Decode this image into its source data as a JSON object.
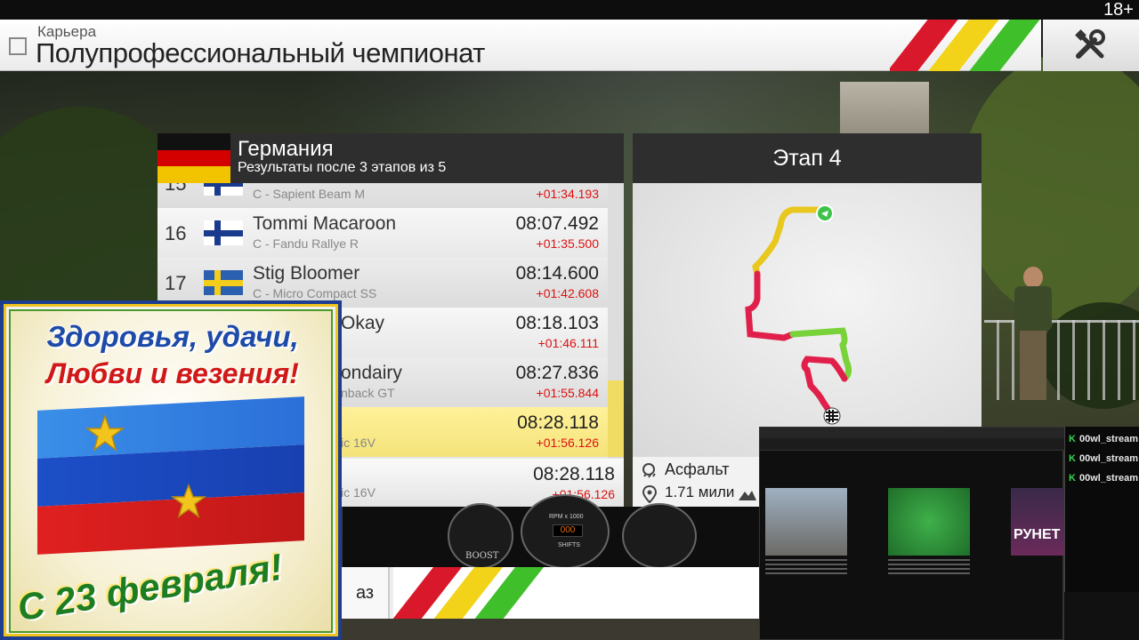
{
  "top": {
    "age_rating": "18+"
  },
  "header": {
    "breadcrumb": "Карьера",
    "title": "Полупрофессиональный чемпионат",
    "stripe_colors": [
      "#d9182b",
      "#f2d31a",
      "#3fbf2a"
    ]
  },
  "results": {
    "country": "Германия",
    "subtitle": "Результаты после 3 этапов из 5",
    "rows": [
      {
        "pos": "15",
        "name": "",
        "car": "C - Sapient Beam M",
        "time": "",
        "gap": "+01:34.193",
        "flag": "finland"
      },
      {
        "pos": "16",
        "name": "Tommi Macaroon",
        "car": "C - Fandu Rallye R",
        "time": "08:07.492",
        "gap": "+01:35.500",
        "flag": "finland"
      },
      {
        "pos": "17",
        "name": "Stig Bloomer",
        "car": "C - Micro Compact SS",
        "time": "08:14.600",
        "gap": "+01:42.608",
        "flag": "sweden"
      },
      {
        "pos": "",
        "name": "Okay",
        "car": "",
        "time": "08:18.103",
        "gap": "+01:46.111",
        "flag": ""
      },
      {
        "pos": "",
        "name": "ondairy",
        "car": "nback GT",
        "time": "08:27.836",
        "gap": "+01:55.844",
        "flag": ""
      },
      {
        "pos": "",
        "name": "",
        "car": "ic 16V",
        "time": "08:28.118",
        "gap": "+01:56.126",
        "flag": ""
      }
    ],
    "player": {
      "car": "ic 16V",
      "time": "08:28.118",
      "gap": "+01:56.126"
    }
  },
  "stage": {
    "title": "Этап 4",
    "surface": "Асфальт",
    "distance": "1.71 мили"
  },
  "bottom": {
    "button_label": "аз"
  },
  "dashboard": {
    "boost_label": "BOOST",
    "rpm_label": "RPM x 1000",
    "shifts_label": "SHIFTS"
  },
  "card": {
    "line1": "Здоровья, удачи,",
    "line2": "Любви и везения!",
    "line3": "С 23 февраля!"
  },
  "stream": {
    "channel_text": "РУНЕТ",
    "chat": [
      "00wl_stream",
      "00wl_stream",
      "00wl_stream"
    ]
  }
}
